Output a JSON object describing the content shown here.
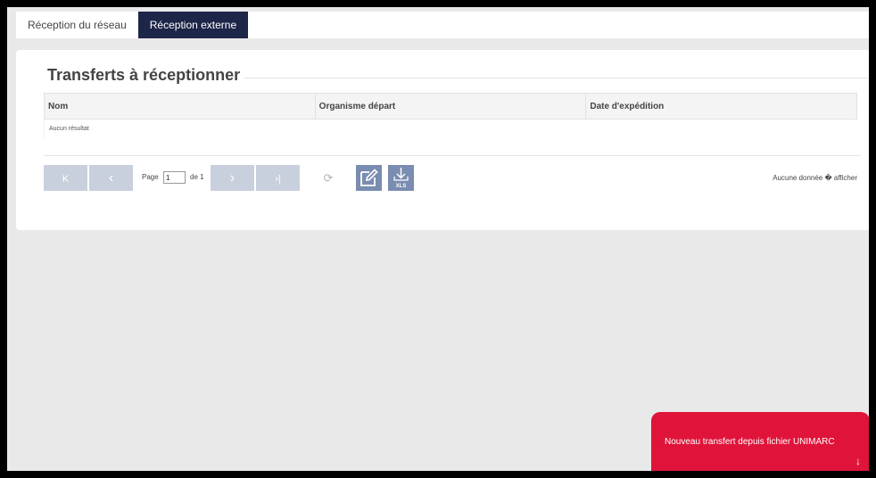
{
  "tabs": [
    {
      "label": "Réception du réseau",
      "active": false
    },
    {
      "label": "Réception externe",
      "active": true
    }
  ],
  "panel": {
    "title": "Transferts à réceptionner"
  },
  "grid": {
    "columns": [
      "Nom",
      "Organisme départ",
      "Date d'expédition"
    ],
    "empty_message": "Aucun résultat"
  },
  "pager": {
    "first_glyph": "K",
    "prev_glyph": "‹",
    "next_glyph": "›",
    "last_glyph": "›|",
    "page_label": "Page",
    "current_page": "1",
    "of_label": "de 1",
    "refresh_glyph": "⟳",
    "xls_label": "XLS",
    "no_data_text": "Aucune donnée � afficher"
  },
  "toast": {
    "text": "Nouveau transfert depuis fichier UNIMARC",
    "arrow_glyph": "↓"
  },
  "colors": {
    "tab_active": "#1d2548",
    "pager_button": "#c9d0dd",
    "action_button": "#7a8cb0",
    "toast": "#e0143a"
  }
}
